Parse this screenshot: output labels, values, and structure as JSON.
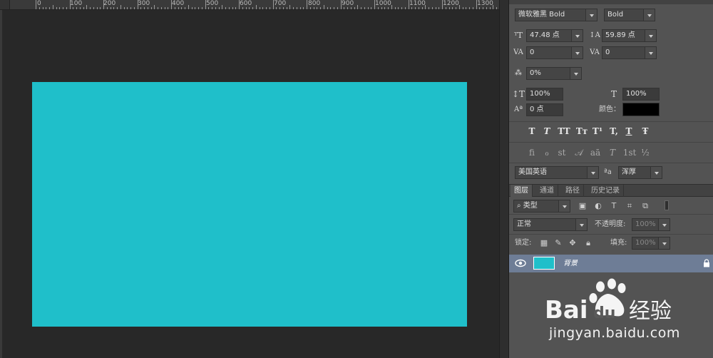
{
  "ruler": {
    "labels": [
      "0",
      "100",
      "200",
      "300",
      "400",
      "500",
      "600",
      "700",
      "800",
      "900",
      "1000",
      "1100",
      "1200",
      "1300"
    ]
  },
  "canvas": {
    "document_color": "#1fbfca"
  },
  "character": {
    "font_family": "微软雅黑 Bold",
    "font_style": "Bold",
    "font_size": "47.48 点",
    "leading": "59.89 点",
    "kerning": "0",
    "tracking": "0",
    "tsume": "0%",
    "vertical_scale": "100%",
    "horizontal_scale": "100%",
    "baseline_shift": "0 点",
    "color_label": "颜色：",
    "text_color": "#000000",
    "style_buttons": [
      "T",
      "T",
      "TT",
      "Tт",
      "T¹",
      "T,",
      "T",
      "Ŧ"
    ],
    "opentype_buttons": [
      "fi",
      "ℴ",
      "st",
      "𝒜",
      "aā",
      "T",
      "1st",
      "½"
    ],
    "language": "美国英语",
    "aa_icon": "ªa",
    "antialias": "浑厚"
  },
  "layers": {
    "tabs": [
      "图层",
      "通道",
      "路径",
      "历史记录"
    ],
    "filter_kind": "类型",
    "blend_mode": "正常",
    "opacity_label": "不透明度:",
    "opacity_value": "100%",
    "lock_label": "锁定:",
    "fill_label": "填充:",
    "fill_value": "100%",
    "items": [
      {
        "name": "背景",
        "thumb_color": "#1fbfca",
        "locked": true
      }
    ]
  },
  "watermark": {
    "brand": "Bai du 经验",
    "url": "jingyan.baidu.com"
  },
  "colors": {
    "panel": "#535353",
    "selection": "#6e7d96",
    "canvas_bg": "#282828"
  }
}
